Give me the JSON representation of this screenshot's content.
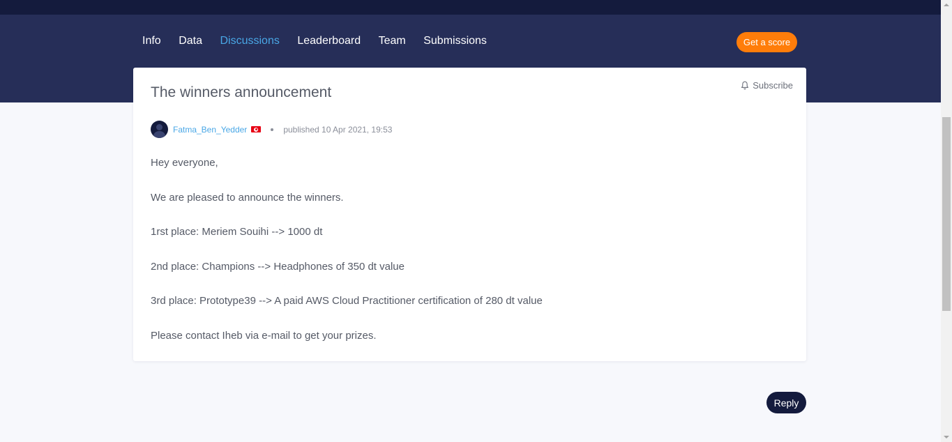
{
  "nav": {
    "items": [
      {
        "label": "Info",
        "active": false
      },
      {
        "label": "Data",
        "active": false
      },
      {
        "label": "Discussions",
        "active": true
      },
      {
        "label": "Leaderboard",
        "active": false
      },
      {
        "label": "Team",
        "active": false
      },
      {
        "label": "Submissions",
        "active": false
      }
    ],
    "score_button": "Get a score"
  },
  "post": {
    "title": "The winners announcement",
    "subscribe_label": "Subscribe",
    "author": "Fatma_Ben_Yedder",
    "published": "published 10 Apr 2021, 19:53",
    "paragraphs": [
      "Hey everyone,",
      "We are pleased to announce the winners.",
      "1rst place: Meriem Souihi --> 1000 dt",
      "2nd place: Champions --> Headphones of 350 dt value",
      "3rd place: Prototype39 --> A paid AWS Cloud Practitioner certification of 280 dt value",
      "Please contact Iheb via e-mail to get your prizes."
    ]
  },
  "reply_button": "Reply",
  "colors": {
    "header_dark": "#141b3d",
    "header": "#262e58",
    "accent_blue": "#49a7e6",
    "accent_orange": "#ff7d0a",
    "flag_red": "#e70013"
  },
  "icons": {
    "subscribe": "bell-icon",
    "author_flag": "tunisia-flag-icon",
    "avatar": "user-avatar-icon"
  }
}
